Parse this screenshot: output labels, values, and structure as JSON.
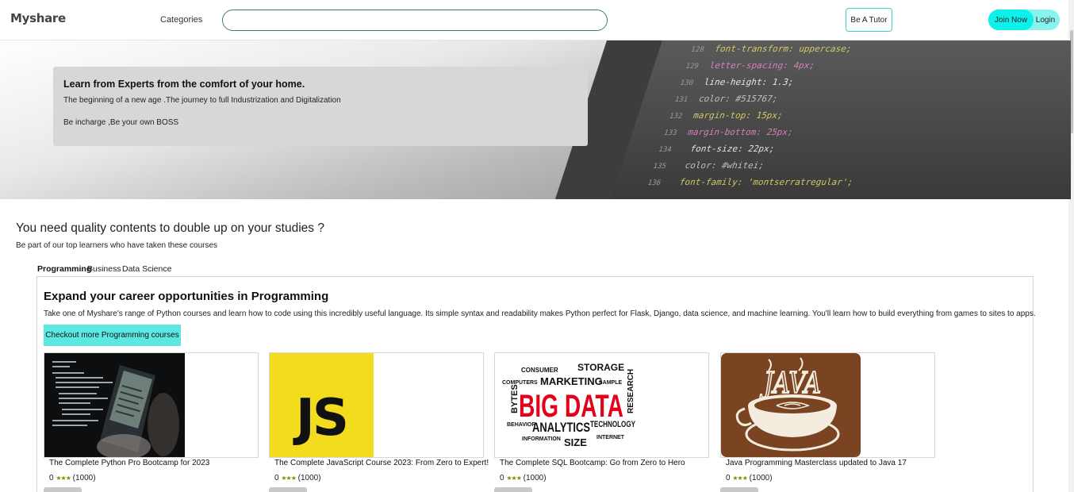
{
  "header": {
    "brand": "Myshare",
    "categories_label": "Categories",
    "search_placeholder": "",
    "tutor_label": "Be A Tutor",
    "join_label": "Join Now",
    "login_label": "Login"
  },
  "hero": {
    "title": "Learn from Experts from the comfort of your home.",
    "subtitle": "The beginning of a new age .The journey to full Industrization and Digitalization",
    "tagline": "Be incharge ,Be your own BOSS",
    "code_text": [
      "font-transform: uppercase;",
      "letter-spacing: 4px;",
      "line-height: 1.3;",
      "color: #515767;",
      "margin-top: 15px;",
      "margin-bottom: 25px;",
      "font-size: 22px;",
      "color: #whitei;",
      "font-family: 'montserratregular';"
    ]
  },
  "main": {
    "title": "You need quality contents to double up on your studies ?",
    "subtitle": "Be part of our top learners who have taken these courses"
  },
  "tabs": [
    {
      "label": "Programming",
      "active": true
    },
    {
      "label": "Business",
      "active": false
    },
    {
      "label": "Data Science",
      "active": false
    }
  ],
  "panel": {
    "title": "Expand your career opportunities in Programming",
    "description": "Take one of Myshare's range of Python courses and learn how to code using this incredibly useful language. Its simple syntax and readability makes Python perfect for Flask, Django, data science, and machine learning. You'll learn how to build everything from games to sites to apps.",
    "button_label": "Checkout more Programming courses"
  },
  "courses": [
    {
      "title": "The Complete Python Pro Bootcamp for 2023",
      "rating": "0",
      "stars": "★★★",
      "count": "(1000)"
    },
    {
      "title": "The Complete JavaScript Course 2023: From Zero to Expert!",
      "rating": "0",
      "stars": "★★★",
      "count": "(1000)"
    },
    {
      "title": "The Complete SQL Bootcamp: Go from Zero to Hero",
      "rating": "0",
      "stars": "★★★",
      "count": "(1000)"
    },
    {
      "title": "Java Programming Masterclass updated to Java 17",
      "rating": "0",
      "stars": "★★★",
      "count": "(1000)"
    }
  ],
  "thumbs": {
    "js_text": "JS",
    "java_text": "JAVA",
    "bigdata_words": [
      "CONSUMER",
      "STORAGE",
      "COMPUTERS",
      "MARKETING",
      "SAMPLE",
      "BYTES",
      "BIG DATA",
      "RESEARCH",
      "BEHAVIOR",
      "ANALYTICS",
      "TECHNOLOGY",
      "INFORMATION",
      "SIZE",
      "INTERNET"
    ]
  },
  "colors": {
    "accent": "#0ef0ea",
    "accent_light": "#8af3ee",
    "button": "#5ce8e0",
    "search_border": "#3e7f6a",
    "star": "#8a8a00",
    "js_yellow": "#f2dc1d",
    "java_brown": "#7a4422",
    "bigdata_red": "#e2001a"
  }
}
